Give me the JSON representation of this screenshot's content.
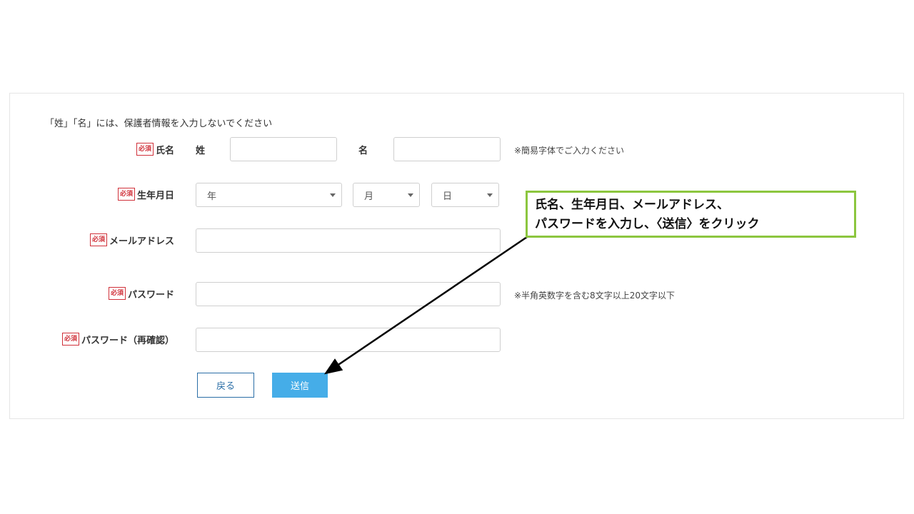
{
  "form": {
    "notice": "「姓」「名」には、保護者情報を入力しないでください",
    "required_badge": "必須",
    "name": {
      "label": "氏名",
      "sei_label": "姓",
      "mei_label": "名",
      "sei_value": "",
      "mei_value": "",
      "hint": "※簡易字体でご入力ください"
    },
    "birthdate": {
      "label": "生年月日",
      "year": "年",
      "month": "月",
      "day": "日"
    },
    "email": {
      "label": "メールアドレス",
      "value": ""
    },
    "password": {
      "label": "パスワード",
      "value": "",
      "hint": "※半角英数字を含む8文字以上20文字以下"
    },
    "password_confirm": {
      "label": "パスワード（再確認）",
      "value": ""
    },
    "buttons": {
      "back": "戻る",
      "submit": "送信"
    }
  },
  "annotation": {
    "line1": "氏名、生年月日、メールアドレス、",
    "line2": "パスワードを入力し、〈送信〉をクリック",
    "border_color": "#8cc63f"
  },
  "colors": {
    "required_red": "#d0313a",
    "submit_blue": "#45ade8",
    "back_blue": "#2a6ea6"
  }
}
